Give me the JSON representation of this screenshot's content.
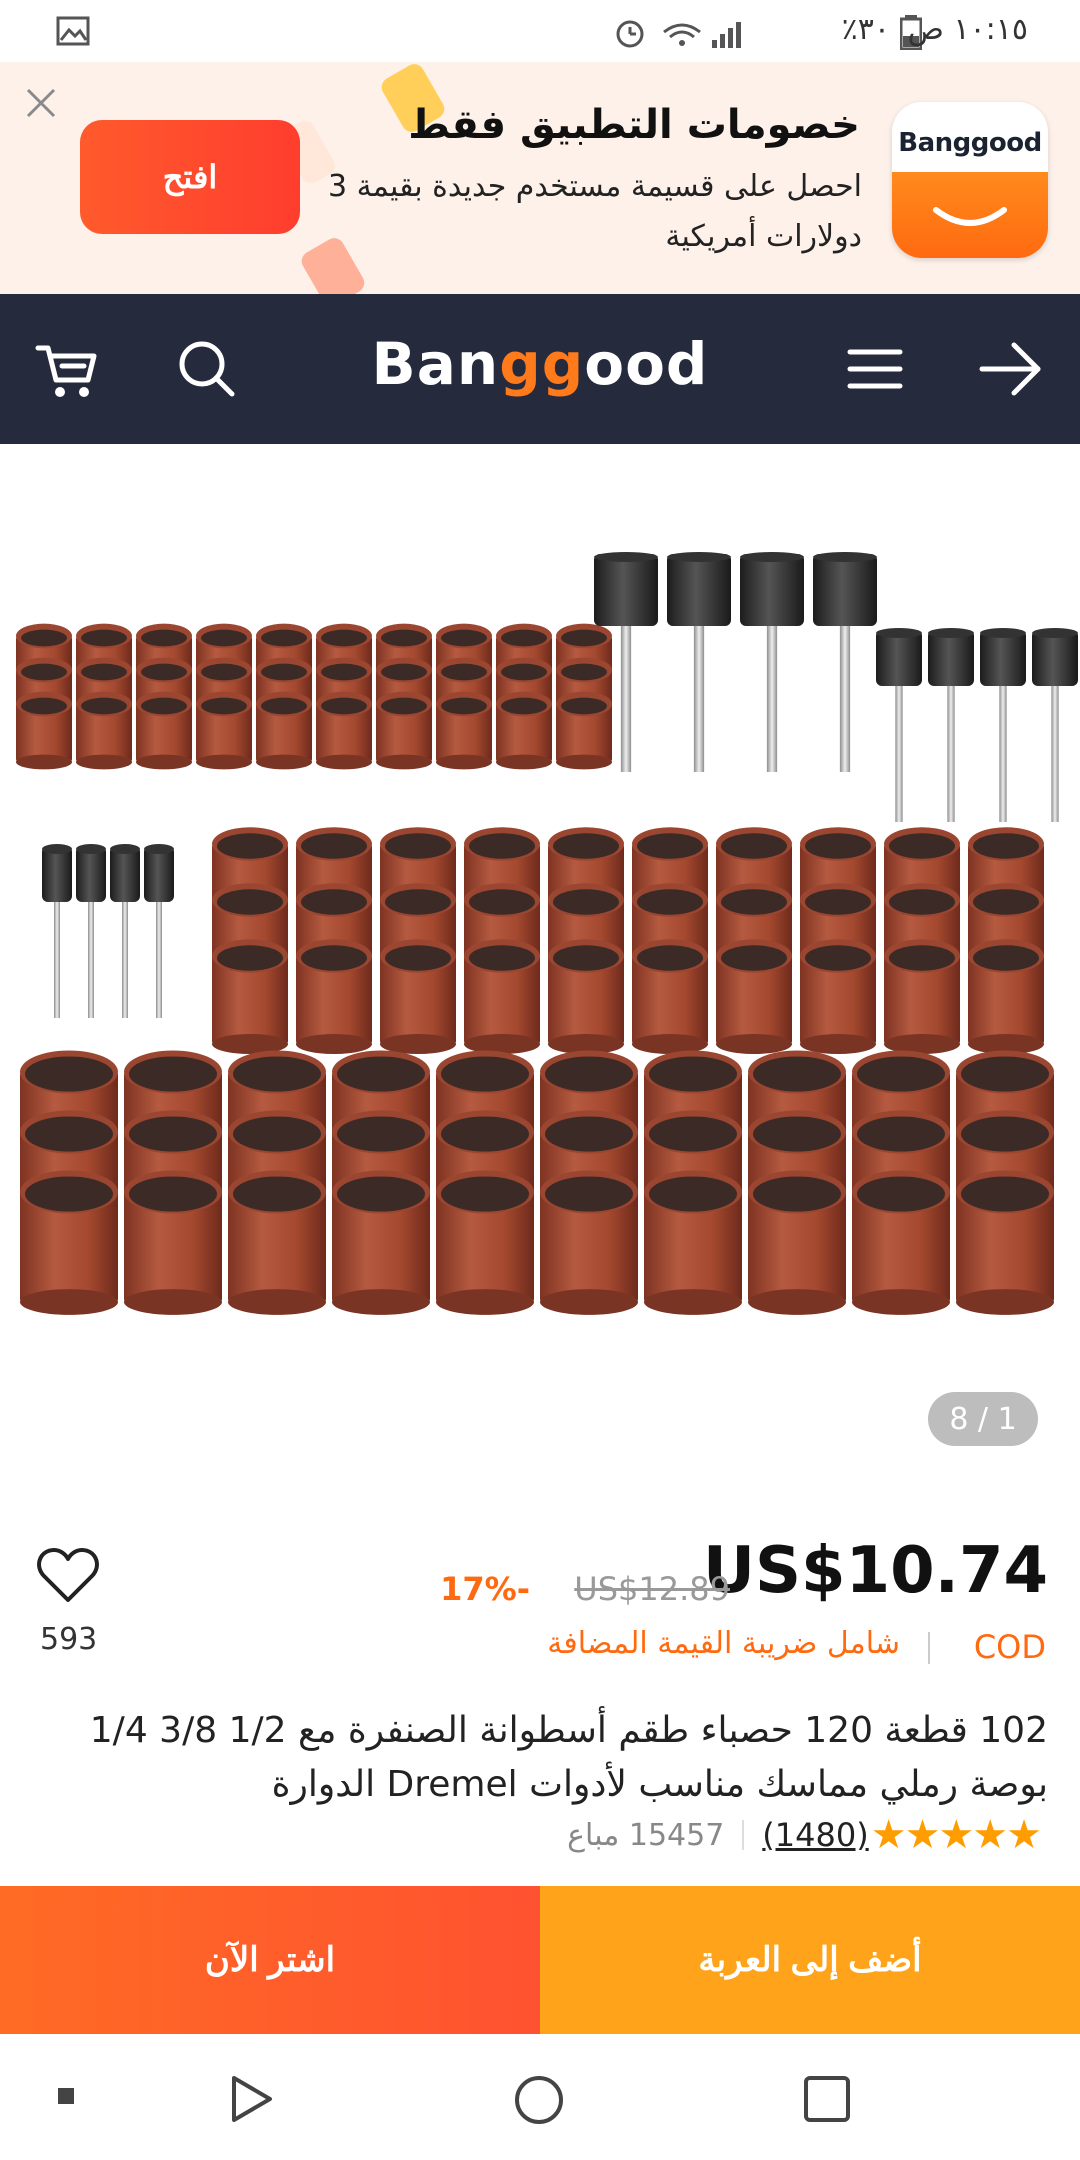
{
  "status_bar": {
    "time": "١٠:١٥ ص",
    "battery": "٣٠٪"
  },
  "promo": {
    "title": "خصومات التطبيق فقط",
    "description": "احصل على قسيمة مستخدم جديدة بقيمة 3 دولارات أمريكية",
    "open_label": "افتح",
    "app_name": "Banggood"
  },
  "header": {
    "logo_prefix": "Ban",
    "logo_highlight": "gg",
    "logo_suffix": "ood"
  },
  "gallery": {
    "counter": "8 / 1"
  },
  "product": {
    "price": "US$10.74",
    "old_price": "US$12.89",
    "discount": "17%-",
    "cod": "COD",
    "vat": "شامل ضريبة القيمة المضافة",
    "wishlist_count": "593",
    "title": "102 قطعة 120 حصباء طقم أسطوانة الصنفرة مع 1/2 3/8 1/4 بوصة رملي مماسك مناسب لأدوات Dremel الدوارة",
    "stars": "★★★★★",
    "rating": 5,
    "reviews": "(1480)",
    "sold": "15457 مباع"
  },
  "actions": {
    "add_to_cart": "أضف إلى العربة",
    "buy_now": "اشتر الآن"
  },
  "colors": {
    "header_bg": "#262a3d",
    "accent_orange": "#ff6a10",
    "cart_yellow": "#ffa31a",
    "sandpaper_red": "#a0452e"
  }
}
